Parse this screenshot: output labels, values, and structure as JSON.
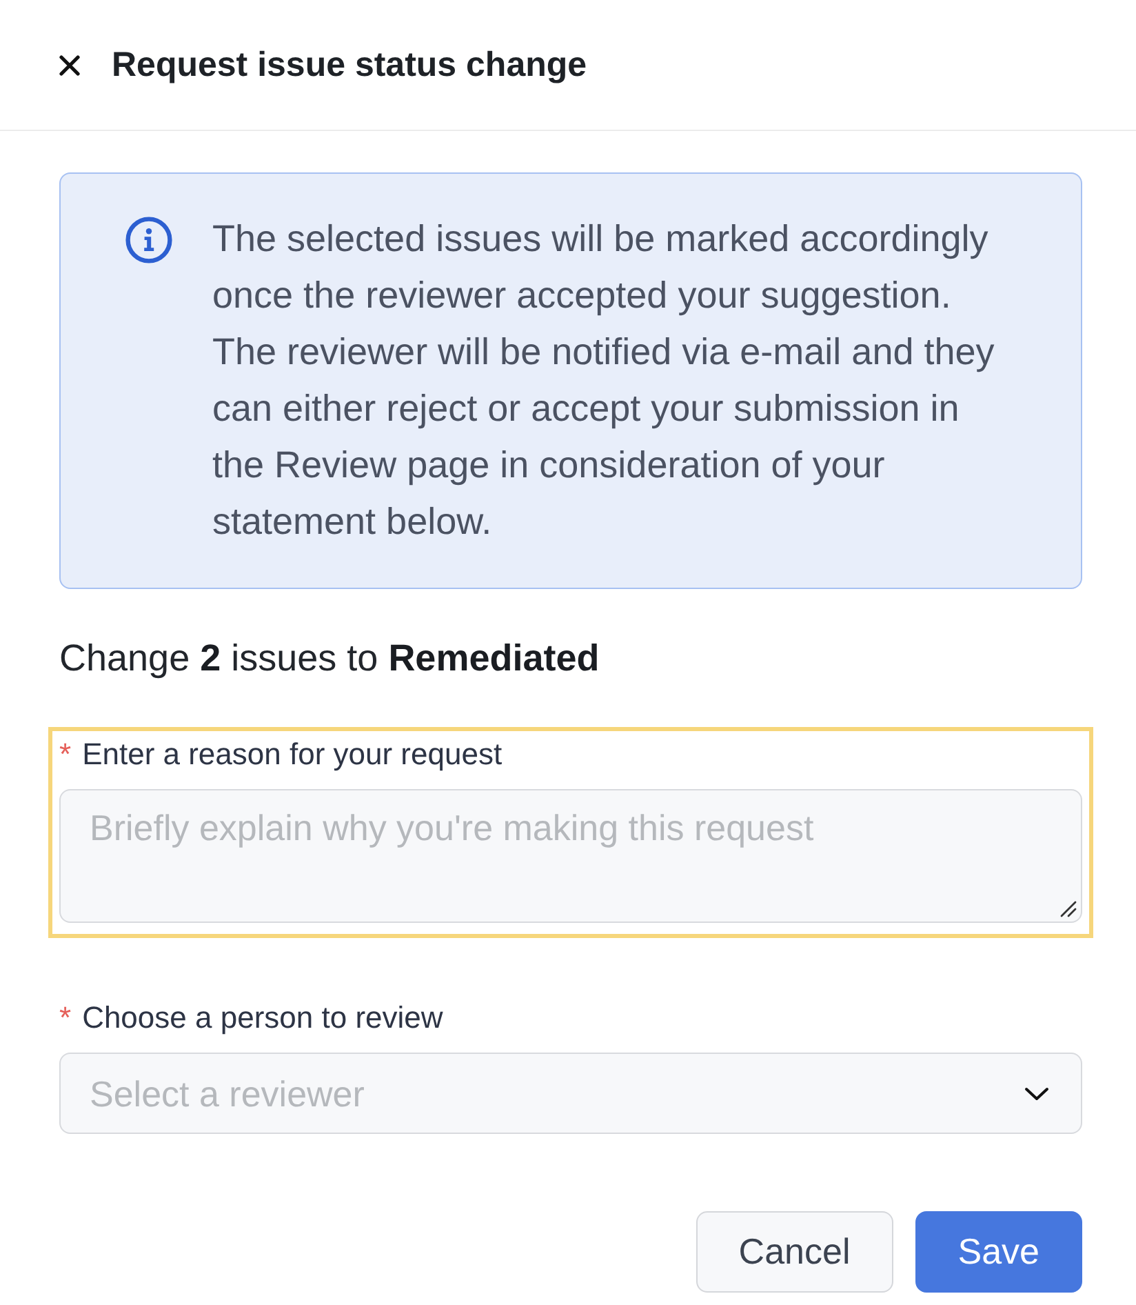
{
  "header": {
    "title": "Request issue status change"
  },
  "notice": {
    "text": "The selected issues will be marked accordingly once the reviewer accepted your suggestion. The reviewer will be notified via e-mail and they can either reject or accept your submission in the Review page in consideration of your statement below."
  },
  "summary": {
    "text": "Change **2** issues to **Remediated**"
  },
  "fields": [
    {
      "kind": "textarea",
      "required_mark": "*",
      "label": "Enter a reason for your request",
      "placeholder": "Briefly explain why you're making this request",
      "highlighted": true
    },
    {
      "kind": "select",
      "required_mark": "*",
      "label": "Choose a person to review",
      "placeholder": "Select a reviewer",
      "highlighted": false
    }
  ],
  "buttons": [
    {
      "kind": "secondary",
      "label": "Cancel"
    },
    {
      "kind": "primary",
      "label": "Save"
    }
  ]
}
